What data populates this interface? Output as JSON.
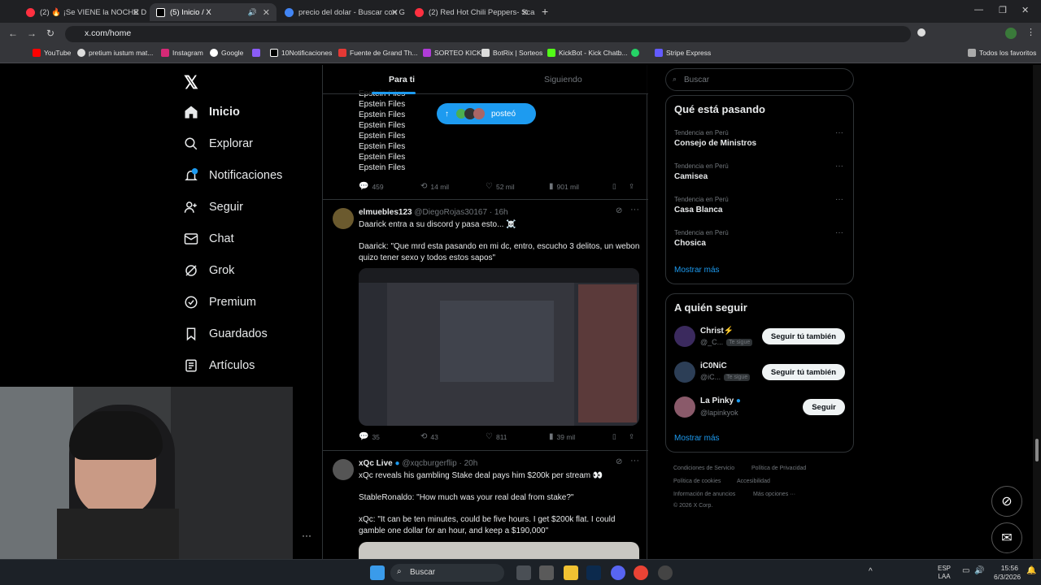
{
  "browser": {
    "tabs": [
      {
        "title": "(2) 🔥 ¡Se VIENE la NOCHE DO",
        "color": "#ff3040"
      },
      {
        "title": "(5) Inicio / X",
        "color": "#ffffff"
      },
      {
        "title": "precio del dolar - Buscar con G",
        "color": "#4285f4"
      },
      {
        "title": "(2) Red Hot Chili Peppers- Scar",
        "color": "#ff3040"
      }
    ],
    "url": "x.com/home",
    "bookmarks": [
      "YouTube",
      "pretium iustum mat...",
      "Instagram",
      "Google",
      "",
      "10Notificaciones",
      "Fuente de Grand Th...",
      "SORTEO KICK",
      "BotRix | Sorteos",
      "KickBot - Kick Chatb...",
      "",
      "Stripe Express"
    ],
    "all_favorites": "Todos los favoritos"
  },
  "nav": {
    "items": [
      "Inicio",
      "Explorar",
      "Notificaciones",
      "Seguir",
      "Chat",
      "Grok",
      "Premium",
      "Guardados",
      "Artículos"
    ],
    "notif_badge": "5"
  },
  "feed": {
    "tabs": [
      "Para ti",
      "Siguiendo"
    ],
    "posted_pill": "posteó",
    "epstein_lines": [
      "Epstein Files",
      "Epstein Files",
      "Epstein Files",
      "Epstein Files",
      "Epstein Files",
      "Epstein Files",
      "Epstein Files",
      "Epstein Files"
    ],
    "post0_actions": {
      "replies": "459",
      "reposts": "14 mil",
      "likes": "52 mil",
      "views": "901 mil"
    },
    "post1": {
      "name": "elmuebles123",
      "handle": "@DiegoRojas30167 · 16h",
      "text1": "Daarick entra a su discord y pasa esto... ☠️",
      "text2": "Daarick: \"Que mrd esta pasando en mi dc, entro, escucho 3 delitos, un webon quizo tener sexo y todos estos sapos\"",
      "actions": {
        "replies": "35",
        "reposts": "43",
        "likes": "811",
        "views": "39 mil"
      }
    },
    "post2": {
      "name": "xQc Live",
      "handle": "@xqcburgerflip · 20h",
      "text1": "xQc reveals his gambling Stake deal pays him $200k per stream 👀",
      "text2": "StableRonaldo: \"How much was your real deal from stake?\"",
      "text3": "xQc: \"It can be ten minutes, could be five hours. I get $200k flat. I could gamble one dollar for an hour, and keep a $190,000\""
    }
  },
  "right": {
    "search_placeholder": "Buscar",
    "trends_title": "Qué está pasando",
    "trends": [
      {
        "context": "Tendencia en Perú",
        "topic": "Consejo de Ministros"
      },
      {
        "context": "Tendencia en Perú",
        "topic": "Camisea"
      },
      {
        "context": "Tendencia en Perú",
        "topic": "Casa Blanca"
      },
      {
        "context": "Tendencia en Perú",
        "topic": "Chosica"
      }
    ],
    "show_more": "Mostrar más",
    "follow_title": "A quién seguir",
    "follow": [
      {
        "name": "Christ⚡",
        "handle": "@_C...",
        "badge": "Te sigue",
        "button": "Seguir tú también"
      },
      {
        "name": "iC0NiC",
        "handle": "@iC...",
        "badge": "Te sigue",
        "button": "Seguir tú también"
      },
      {
        "name": "La Pinky",
        "handle": "@lapinkyok",
        "badge": "",
        "button": "Seguir"
      }
    ],
    "show_more2": "Mostrar más",
    "footer": [
      "Condiciones de Servicio",
      "Política de Privacidad",
      "Política de cookies",
      "Accesibilidad",
      "Información de anuncios",
      "Más opciones ···",
      "© 2026 X Corp."
    ]
  },
  "taskbar": {
    "search": "Buscar",
    "lang": "ESP",
    "lang2": "LAA",
    "time": "15:56",
    "date": "6/3/2026"
  }
}
